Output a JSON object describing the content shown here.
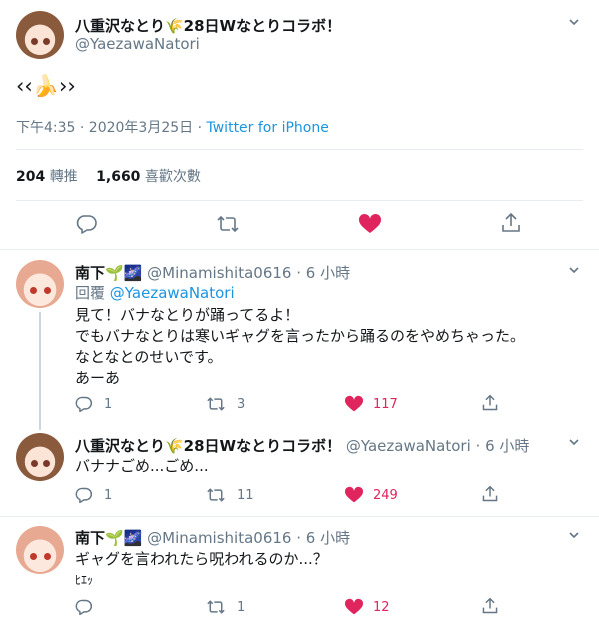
{
  "main_tweet": {
    "display_name": "八重沢なとり🌾28日Wなとりコラボ！",
    "handle": "@YaezawaNatori",
    "content": "‹‹🍌››",
    "timestamp": "下午4:35 · 2020年3月25日 ·",
    "source": "Twitter for iPhone",
    "retweets_count": "204",
    "retweets_label": "轉推",
    "likes_count": "1,660",
    "likes_label": "喜歡次數"
  },
  "replies": [
    {
      "display_name": "南下🌱🌌",
      "handle": "@Minamishita0616",
      "time": "· 6 小時",
      "reply_label": "回覆",
      "reply_to": "@YaezawaNatori",
      "lines": [
        "見て！バナなとりが踊ってるよ！",
        "でもバナなとりは寒いギャグを言ったから踊るのをやめちゃった。",
        "なとなとのせいです。",
        "あーあ"
      ],
      "replies": "1",
      "retweets": "3",
      "likes": "117"
    },
    {
      "display_name": "八重沢なとり🌾28日Wなとりコラボ！",
      "handle": "@YaezawaNatori",
      "time": "· 6 小時",
      "lines": [
        "バナナごめ...ごめ..."
      ],
      "replies": "1",
      "retweets": "11",
      "likes": "249"
    },
    {
      "display_name": "南下🌱🌌",
      "handle": "@Minamishita0616",
      "time": "· 6 小時",
      "lines": [
        "ギャグを言われたら呪われるのか...？",
        "ﾋｴｯ"
      ],
      "replies": "",
      "retweets": "1",
      "likes": "12"
    }
  ],
  "colors": {
    "accent": "#1b95e0",
    "like": "#e0245e",
    "muted": "#657786"
  }
}
